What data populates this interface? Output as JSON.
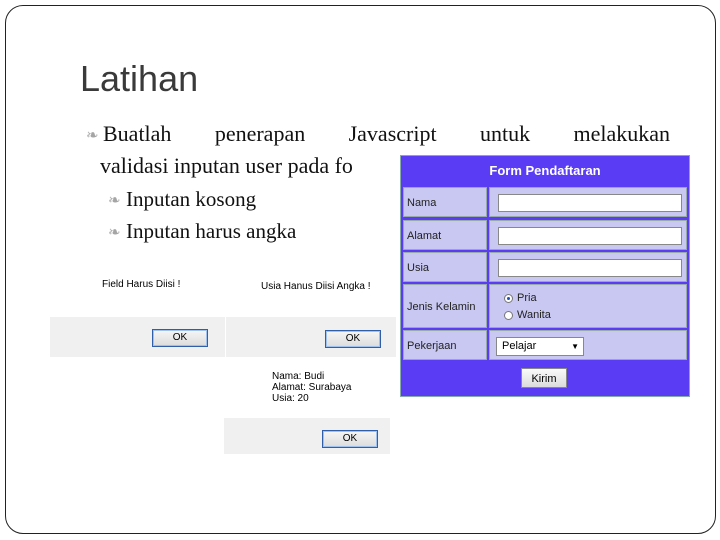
{
  "slide": {
    "title": "Latihan",
    "bullet_main_words": [
      "Buatlah",
      "penerapan",
      "Javascript",
      "untuk",
      "melakukan"
    ],
    "bullet_main_line2": "validasi inputan user pada fo",
    "sub_bullets": [
      "Inputan kosong",
      "Inputan harus angka"
    ],
    "bullet_glyph": "❧"
  },
  "alerts": [
    {
      "message": "Field Harus Diisi !",
      "ok": "OK"
    },
    {
      "message": "Usia Hanus Diisi Angka !",
      "ok": "OK"
    },
    {
      "message": "Nama: Budi\nAlamat: Surabaya\nUsia: 20",
      "ok": "OK"
    }
  ],
  "form": {
    "title": "Form Pendaftaran",
    "labels": {
      "nama": "Nama",
      "alamat": "Alamat",
      "usia": "Usia",
      "jenis_kelamin": "Jenis Kelamin",
      "pekerjaan": "Pekerjaan"
    },
    "gender_options": [
      "Pria",
      "Wanita"
    ],
    "gender_selected": "Pria",
    "pekerjaan_value": "Pelajar",
    "submit_label": "Kirim"
  }
}
